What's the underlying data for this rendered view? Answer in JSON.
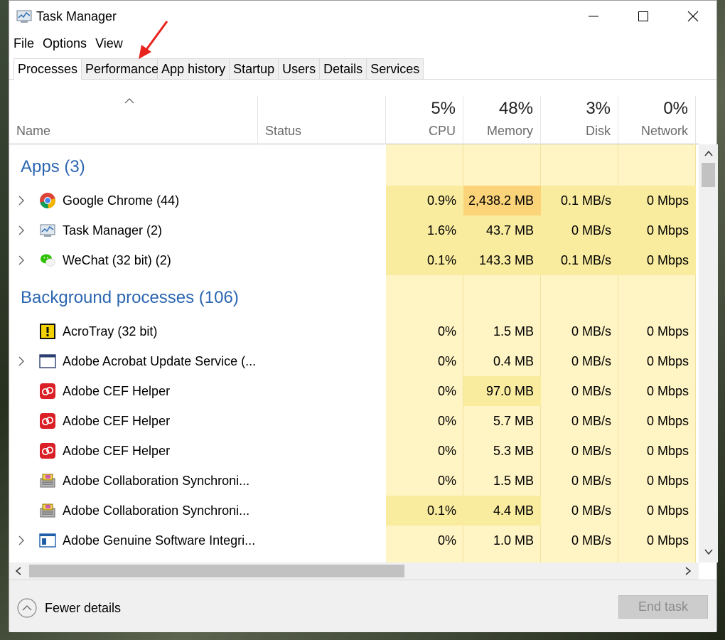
{
  "window": {
    "title": "Task Manager",
    "app_icon": "task-manager-icon"
  },
  "menu": [
    "File",
    "Options",
    "View"
  ],
  "tabs": [
    "Processes",
    "Performance",
    "App history",
    "Startup",
    "Users",
    "Details",
    "Services"
  ],
  "active_tab": "Processes",
  "header": {
    "name": "Name",
    "status": "Status",
    "cpu": {
      "pct": "5%",
      "label": "CPU"
    },
    "memory": {
      "pct": "48%",
      "label": "Memory"
    },
    "disk": {
      "pct": "3%",
      "label": "Disk"
    },
    "network": {
      "pct": "0%",
      "label": "Network"
    }
  },
  "groups": {
    "apps": "Apps (3)",
    "background": "Background processes (106)"
  },
  "apps": [
    {
      "name": "Google Chrome (44)",
      "cpu": "0.9%",
      "memory": "2,438.2 MB",
      "disk": "0.1 MB/s",
      "network": "0 Mbps",
      "icon": "chrome-icon"
    },
    {
      "name": "Task Manager (2)",
      "cpu": "1.6%",
      "memory": "43.7 MB",
      "disk": "0 MB/s",
      "network": "0 Mbps",
      "icon": "task-manager-icon"
    },
    {
      "name": "WeChat (32 bit) (2)",
      "cpu": "0.1%",
      "memory": "143.3 MB",
      "disk": "0.1 MB/s",
      "network": "0 Mbps",
      "icon": "wechat-icon"
    }
  ],
  "background": [
    {
      "name": "AcroTray (32 bit)",
      "cpu": "0%",
      "memory": "1.5 MB",
      "disk": "0 MB/s",
      "network": "0 Mbps",
      "icon": "acrotray-icon"
    },
    {
      "name": "Adobe Acrobat Update Service (...",
      "cpu": "0%",
      "memory": "0.4 MB",
      "disk": "0 MB/s",
      "network": "0 Mbps",
      "icon": "service-window-icon"
    },
    {
      "name": "Adobe CEF Helper",
      "cpu": "0%",
      "memory": "97.0 MB",
      "disk": "0 MB/s",
      "network": "0 Mbps",
      "icon": "adobe-cc-icon"
    },
    {
      "name": "Adobe CEF Helper",
      "cpu": "0%",
      "memory": "5.7 MB",
      "disk": "0 MB/s",
      "network": "0 Mbps",
      "icon": "adobe-cc-icon"
    },
    {
      "name": "Adobe CEF Helper",
      "cpu": "0%",
      "memory": "5.3 MB",
      "disk": "0 MB/s",
      "network": "0 Mbps",
      "icon": "adobe-cc-icon"
    },
    {
      "name": "Adobe Collaboration Synchroni...",
      "cpu": "0%",
      "memory": "1.5 MB",
      "disk": "0 MB/s",
      "network": "0 Mbps",
      "icon": "collaboration-sync-icon"
    },
    {
      "name": "Adobe Collaboration Synchroni...",
      "cpu": "0.1%",
      "memory": "4.4 MB",
      "disk": "0 MB/s",
      "network": "0 Mbps",
      "icon": "collaboration-sync-icon"
    },
    {
      "name": "Adobe Genuine Software Integri...",
      "cpu": "0%",
      "memory": "1.0 MB",
      "disk": "0 MB/s",
      "network": "0 Mbps",
      "icon": "genuine-software-icon"
    }
  ],
  "footer": {
    "fewer_details": "Fewer details",
    "end_task": "End task"
  },
  "colors": {
    "heat_light": "#fff4c4",
    "heat_mid": "#f9ec9f",
    "heat_high": "#fbd47a",
    "group_title": "#2b66b1",
    "annotation_arrow": "#e8231e"
  }
}
